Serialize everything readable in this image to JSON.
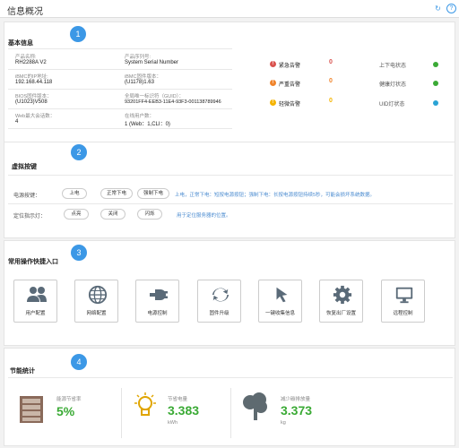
{
  "header": {
    "title": "信息概况",
    "refresh_icon": "refresh-icon",
    "help_icon": "help-icon"
  },
  "basic": {
    "badge": "1",
    "title": "基本信息",
    "fields": [
      {
        "label": "产品名称:",
        "value": "RH2288A V2"
      },
      {
        "label": "产品序列号:",
        "value": "System Serial Number"
      },
      {
        "label": "iBMC的IP地址:",
        "value": "192.168.44.118"
      },
      {
        "label": "iBMC固件版本：",
        "value": "(U1178)1.63"
      },
      {
        "label": "BIOS固件版本：",
        "value": "(U1023)V508"
      },
      {
        "label": "全局唯一标识符（GUID）：",
        "value": "93201FF4-EEB3-11E4-93F3-001138789946"
      },
      {
        "label": "Web最大会话数：",
        "value": "4"
      },
      {
        "label": "在线用户数：",
        "value": "1 (Web：1,CLI：0)"
      }
    ],
    "alarms": [
      {
        "label": "紧急告警",
        "count": "0",
        "color": "#d9534f",
        "count_color": "#d9534f"
      },
      {
        "label": "严重告警",
        "count": "0",
        "color": "#f0842c",
        "count_color": "#f0842c"
      },
      {
        "label": "轻微告警",
        "count": "0",
        "color": "#f5b400",
        "count_color": "#f5b400"
      }
    ],
    "statuses": [
      {
        "label": "上下电状态",
        "color": "#3aaa35"
      },
      {
        "label": "健康灯状态",
        "color": "#3aaa35"
      },
      {
        "label": "UID灯状态",
        "color": "#2aa3d5"
      }
    ]
  },
  "virtual": {
    "badge": "2",
    "title": "虚拟按键",
    "power_label": "电源按键：",
    "power_buttons": [
      "上电",
      "正常下电",
      "强制下电"
    ],
    "power_hint": "上电，正常下电：短按电源按钮；强制下电：长按电源按钮持续5秒，可能会损坏系统数据。",
    "uid_label": "定位指示灯：",
    "uid_buttons": [
      "点亮",
      "关闭",
      "闪烁"
    ],
    "uid_hint": "用于定位服务器的位置。"
  },
  "quick": {
    "badge": "3",
    "title": "常用操作快捷入口",
    "items": [
      {
        "label": "用户配置",
        "icon": "users-icon"
      },
      {
        "label": "网络配置",
        "icon": "globe-icon"
      },
      {
        "label": "电源控制",
        "icon": "plug-icon"
      },
      {
        "label": "固件升级",
        "icon": "sync-icon"
      },
      {
        "label": "一键收集信息",
        "icon": "cursor-icon"
      },
      {
        "label": "恢复出厂设置",
        "icon": "gear-icon"
      },
      {
        "label": "远程控制",
        "icon": "monitor-icon"
      }
    ]
  },
  "energy": {
    "badge": "4",
    "title": "节能统计",
    "items": [
      {
        "label": "能源节省率",
        "value": "5%",
        "unit": "",
        "icon": "server-icon"
      },
      {
        "label": "节省电量",
        "value": "3.383",
        "unit": "kWh",
        "icon": "bulb-icon"
      },
      {
        "label": "减少碳排放量",
        "value": "3.373",
        "unit": "kg",
        "icon": "tree-icon"
      }
    ]
  }
}
